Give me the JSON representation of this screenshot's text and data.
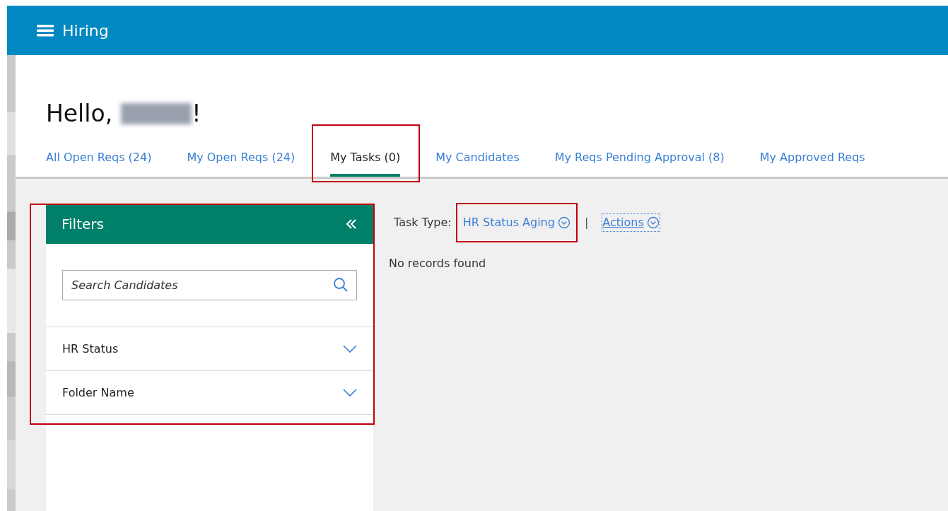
{
  "header": {
    "title": "Hiring"
  },
  "greeting": {
    "prefix": "Hello,",
    "name_redacted": true,
    "suffix": "!"
  },
  "tabs": [
    {
      "label": "All Open Reqs (24)",
      "selected": false,
      "highlighted": false
    },
    {
      "label": "My Open Reqs (24)",
      "selected": false,
      "highlighted": false
    },
    {
      "label": "My Tasks (0)",
      "selected": true,
      "highlighted": true
    },
    {
      "label": "My Candidates",
      "selected": false,
      "highlighted": false
    },
    {
      "label": "My Reqs Pending Approval (8)",
      "selected": false,
      "highlighted": false
    },
    {
      "label": "My Approved Reqs",
      "selected": false,
      "highlighted": false
    }
  ],
  "filters": {
    "title": "Filters",
    "highlighted": true,
    "search": {
      "placeholder": "Search Candidates"
    },
    "items": [
      {
        "label": "HR Status",
        "expanded": false
      },
      {
        "label": "Folder Name",
        "expanded": false
      }
    ]
  },
  "task_bar": {
    "label": "Task Type:",
    "task_type": {
      "value": "HR Status Aging",
      "highlighted": true
    },
    "separator": "|",
    "actions": {
      "label": "Actions",
      "focused": true
    }
  },
  "message": "No records found"
}
